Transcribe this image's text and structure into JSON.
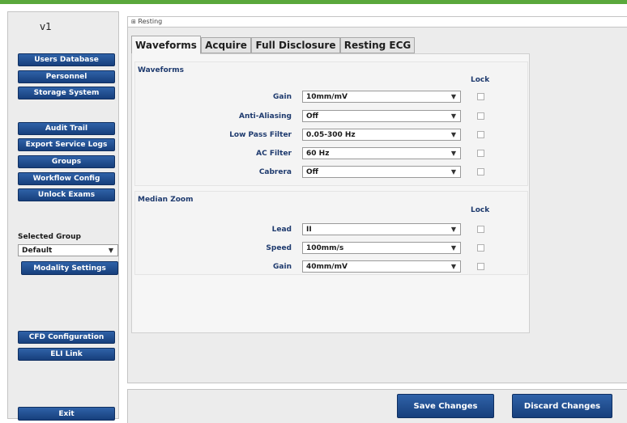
{
  "app": {
    "version": "v1",
    "window_title": "Resting"
  },
  "sidebar": {
    "buttons_top": [
      "Users Database",
      "Personnel",
      "Storage System"
    ],
    "buttons_mid": [
      "Audit Trail",
      "Export Service Logs",
      "Groups",
      "Workflow Config",
      "Unlock Exams"
    ],
    "selected_group_label": "Selected Group",
    "selected_group_value": "Default",
    "modality_settings": "Modality Settings",
    "buttons_bottom": [
      "CFD Configuration",
      "ELI Link"
    ],
    "exit": "Exit"
  },
  "tabs": [
    {
      "label": "Waveforms",
      "active": true
    },
    {
      "label": "Acquire",
      "active": false
    },
    {
      "label": "Full Disclosure",
      "active": false
    },
    {
      "label": "Resting ECG",
      "active": false
    }
  ],
  "waveforms_section": {
    "title": "Waveforms",
    "lock_header": "Lock",
    "fields": [
      {
        "label": "Gain",
        "value": "10mm/mV"
      },
      {
        "label": "Anti-Aliasing",
        "value": "Off"
      },
      {
        "label": "Low Pass Filter",
        "value": "0.05-300 Hz"
      },
      {
        "label": "AC Filter",
        "value": "60 Hz"
      },
      {
        "label": "Cabrera",
        "value": "Off"
      }
    ]
  },
  "median_section": {
    "title": "Median Zoom",
    "lock_header": "Lock",
    "fields": [
      {
        "label": "Lead",
        "value": "II"
      },
      {
        "label": "Speed",
        "value": "100mm/s"
      },
      {
        "label": "Gain",
        "value": "40mm/mV"
      }
    ]
  },
  "actions": {
    "save": "Save Changes",
    "discard": "Discard Changes"
  },
  "icons": {
    "dropdown": "chevron-down-icon",
    "window": "window-icon"
  },
  "colors": {
    "button_blue": "#1f4b8f",
    "label_blue": "#1e3a6e",
    "accent_green": "#5aa83c"
  }
}
